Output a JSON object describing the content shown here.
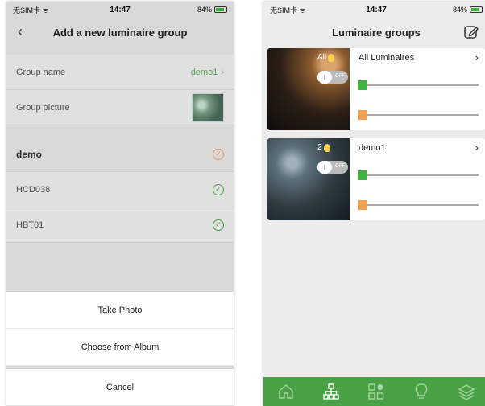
{
  "left": {
    "status": {
      "carrier": "无SIM卡 ᯤ",
      "time": "14:47",
      "battery": "84%"
    },
    "nav": {
      "title": "Add a new luminaire group",
      "back": "‹"
    },
    "rows": {
      "group_name_label": "Group name",
      "group_name_value": "demo1",
      "group_picture_label": "Group picture"
    },
    "group_header": "demo",
    "devices": [
      "HCD038",
      "HBT01"
    ],
    "sheet": {
      "take_photo": "Take Photo",
      "choose_album": "Choose from Album",
      "cancel": "Cancel"
    }
  },
  "right": {
    "status": {
      "carrier": "无SIM卡 ᯤ",
      "time": "14:47",
      "battery": "84%"
    },
    "nav": {
      "title": "Luminaire groups"
    },
    "groups": [
      {
        "count": "All",
        "name": "All Luminaires"
      },
      {
        "count": "2",
        "name": "demo1"
      }
    ],
    "toggle_off": "OFF",
    "tabs": [
      "home-icon",
      "network-icon",
      "scenes-icon",
      "bulb-icon",
      "layers-icon"
    ],
    "colors": {
      "accent": "#4aa145",
      "warm": "#f2a052",
      "cool": "#44b044"
    }
  }
}
